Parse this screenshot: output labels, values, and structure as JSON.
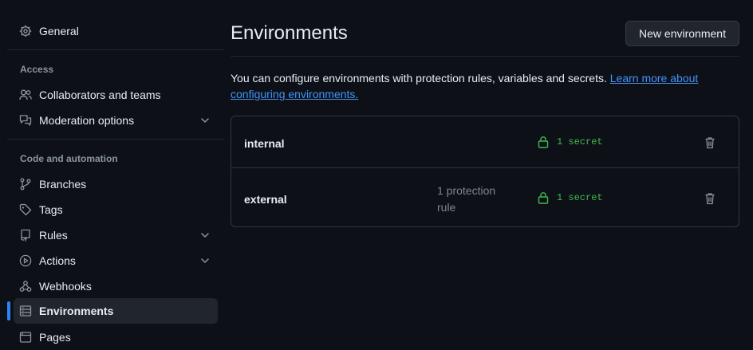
{
  "sidebar": {
    "general": "General",
    "access_heading": "Access",
    "collaborators": "Collaborators and teams",
    "moderation": "Moderation options",
    "code_heading": "Code and automation",
    "branches": "Branches",
    "tags": "Tags",
    "rules": "Rules",
    "actions": "Actions",
    "webhooks": "Webhooks",
    "environments": "Environments",
    "pages": "Pages"
  },
  "main": {
    "title": "Environments",
    "new_button": "New environment",
    "description": "You can configure environments with protection rules, variables and secrets.",
    "learn_more": "Learn more about configuring environments.",
    "environments": [
      {
        "name": "internal",
        "protection": "",
        "secrets": "1 secret"
      },
      {
        "name": "external",
        "protection": "1 protection rule",
        "secrets": "1 secret"
      }
    ]
  },
  "colors": {
    "background": "#0d1117",
    "accent": "#2f81f7",
    "link": "#4493f8",
    "secret_green": "#3fb950"
  }
}
